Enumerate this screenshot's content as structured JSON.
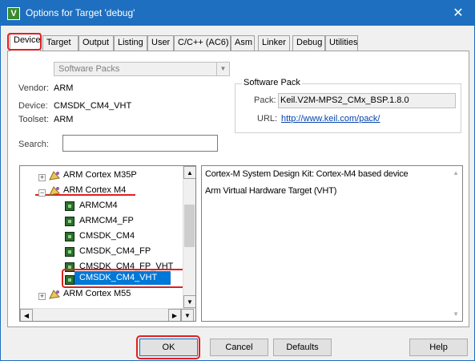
{
  "window": {
    "title": "Options for Target 'debug'",
    "icon_name": "keil-uvision-icon",
    "close_symbol": "✕",
    "accent_color": "#1e6fbf",
    "highlight_color": "#e02020"
  },
  "tabs": [
    {
      "label": "Device",
      "active": true
    },
    {
      "label": "Target"
    },
    {
      "label": "Output"
    },
    {
      "label": "Listing"
    },
    {
      "label": "User"
    },
    {
      "label": "C/C++ (AC6)"
    },
    {
      "label": "Asm"
    },
    {
      "label": "Linker"
    },
    {
      "label": "Debug"
    },
    {
      "label": "Utilities"
    }
  ],
  "device": {
    "database": "Software Packs",
    "vendor_label": "Vendor:",
    "vendor_value": "ARM",
    "device_label": "Device:",
    "device_value": "CMSDK_CM4_VHT",
    "toolset_label": "Toolset:",
    "toolset_value": "ARM",
    "search_label": "Search:",
    "search_value": ""
  },
  "software_pack": {
    "title": "Software Pack",
    "pack_label": "Pack:",
    "pack_value": "Keil.V2M-MPS2_CMx_BSP.1.8.0",
    "url_label": "URL:",
    "url_value": "http://www.keil.com/pack/"
  },
  "tree": {
    "items": [
      {
        "label": "ARM Cortex M35P",
        "kind": "family",
        "expander": "+"
      },
      {
        "label": "ARM Cortex M4",
        "kind": "family",
        "expander": "−"
      },
      {
        "label": "ARMCM4",
        "kind": "device"
      },
      {
        "label": "ARMCM4_FP",
        "kind": "device"
      },
      {
        "label": "CMSDK_CM4",
        "kind": "device"
      },
      {
        "label": "CMSDK_CM4_FP",
        "kind": "device"
      },
      {
        "label": "CMSDK_CM4_FP_VHT",
        "kind": "device"
      },
      {
        "label": "CMSDK_CM4_VHT",
        "kind": "device",
        "selected": true
      },
      {
        "label": "ARM Cortex M55",
        "kind": "family",
        "expander": "+"
      }
    ]
  },
  "description": {
    "lines": [
      "Cortex-M System Design Kit: Cortex-M4 based device",
      "Arm Virtual Hardware Target (VHT)"
    ]
  },
  "buttons": {
    "ok": "OK",
    "cancel": "Cancel",
    "defaults": "Defaults",
    "help": "Help"
  }
}
